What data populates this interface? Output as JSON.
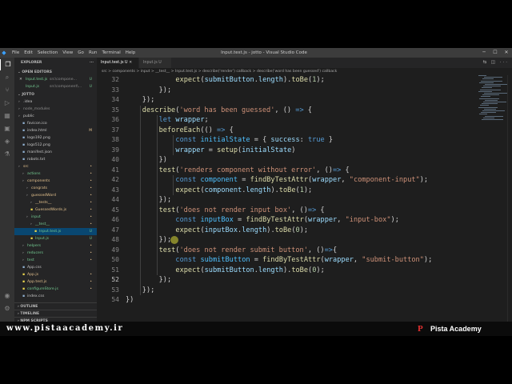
{
  "window": {
    "title": "Input.test.js - jotto - Visual Studio Code",
    "menu": [
      "File",
      "Edit",
      "Selection",
      "View",
      "Go",
      "Run",
      "Terminal",
      "Help"
    ]
  },
  "explorer": {
    "header": "EXPLORER",
    "open_editors_header": "OPEN EDITORS",
    "open_editors": [
      {
        "name": "Input.test.js",
        "path": "src\\compone...",
        "badge": "U"
      },
      {
        "name": "Input.js",
        "path": "src\\component\\...",
        "badge": "U"
      }
    ],
    "project_header": "JOTTO",
    "tree": [
      {
        "label": ".idea",
        "badge": "",
        "indent": 1,
        "kind": "folder"
      },
      {
        "label": "node_modules",
        "badge": "",
        "indent": 1,
        "kind": "folder-dim"
      },
      {
        "label": "public",
        "badge": "",
        "indent": 1,
        "kind": "folder"
      },
      {
        "label": "favicon.ico",
        "badge": "",
        "indent": 2,
        "kind": "file"
      },
      {
        "label": "index.html",
        "badge": "M",
        "indent": 2,
        "kind": "file"
      },
      {
        "label": "logo192.png",
        "badge": "",
        "indent": 2,
        "kind": "file"
      },
      {
        "label": "logo512.png",
        "badge": "",
        "indent": 2,
        "kind": "file"
      },
      {
        "label": "manifest.json",
        "badge": "",
        "indent": 2,
        "kind": "file"
      },
      {
        "label": "robots.txt",
        "badge": "",
        "indent": 2,
        "kind": "file"
      },
      {
        "label": "src",
        "badge": "",
        "indent": 1,
        "kind": "folder-mod"
      },
      {
        "label": "actions",
        "badge": "",
        "indent": 2,
        "kind": "folder-new"
      },
      {
        "label": "components",
        "badge": "",
        "indent": 2,
        "kind": "folder-mod"
      },
      {
        "label": "congrats",
        "badge": "",
        "indent": 3,
        "kind": "folder-mod"
      },
      {
        "label": "guessedWord",
        "badge": "",
        "indent": 3,
        "kind": "folder-mod"
      },
      {
        "label": "__tests__",
        "badge": "",
        "indent": 4,
        "kind": "folder-mod"
      },
      {
        "label": "GuessedWords.js",
        "badge": "",
        "indent": 4,
        "kind": "file-mod"
      },
      {
        "label": "input",
        "badge": "",
        "indent": 3,
        "kind": "folder-new"
      },
      {
        "label": "__test__",
        "badge": "",
        "indent": 4,
        "kind": "folder-new"
      },
      {
        "label": "Input.test.js",
        "badge": "U",
        "indent": 5,
        "kind": "file-new",
        "selected": true
      },
      {
        "label": "Input.js",
        "badge": "U",
        "indent": 4,
        "kind": "file-new"
      },
      {
        "label": "helpers",
        "badge": "",
        "indent": 2,
        "kind": "folder-new"
      },
      {
        "label": "reducers",
        "badge": "",
        "indent": 2,
        "kind": "folder-new"
      },
      {
        "label": "test",
        "badge": "",
        "indent": 2,
        "kind": "folder-new"
      },
      {
        "label": "App.css",
        "badge": "",
        "indent": 2,
        "kind": "file"
      },
      {
        "label": "App.js",
        "badge": "",
        "indent": 2,
        "kind": "file-mod"
      },
      {
        "label": "App.test.js",
        "badge": "",
        "indent": 2,
        "kind": "file-mod"
      },
      {
        "label": "configureStore.js",
        "badge": "",
        "indent": 2,
        "kind": "file-new"
      },
      {
        "label": "index.css",
        "badge": "",
        "indent": 2,
        "kind": "file"
      }
    ],
    "outline": "OUTLINE",
    "timeline": "TIMELINE",
    "npm_scripts": "NPM SCRIPTS"
  },
  "tabs": [
    {
      "label": "Input.test.js  U",
      "active": true
    },
    {
      "label": "Input.js  U",
      "active": false
    }
  ],
  "breadcrumb": "src > components > input > __test__ > Input.test.js > describe('render') callback > describe('word has been guessed') callback",
  "editor": {
    "current_line": 52,
    "line_numbers": [
      "32",
      "33",
      "34",
      "35",
      "36",
      "37",
      "38",
      "39",
      "40",
      "41",
      "42",
      "43",
      "44",
      "45",
      "46",
      "47",
      "48",
      "49",
      "50",
      "51",
      "52",
      "53",
      "54"
    ],
    "lines": [
      {
        "indent": 12,
        "tokens": [
          [
            "fn",
            "expect"
          ],
          [
            "pn",
            "("
          ],
          [
            "var",
            "submitButton"
          ],
          [
            "pn",
            "."
          ],
          [
            "var",
            "length"
          ],
          [
            "pn",
            ")."
          ],
          [
            "fn",
            "toBe"
          ],
          [
            "pn",
            "("
          ],
          [
            "num",
            "1"
          ],
          [
            "pn",
            ");"
          ]
        ]
      },
      {
        "indent": 8,
        "tokens": [
          [
            "pn",
            "});"
          ]
        ]
      },
      {
        "indent": 4,
        "tokens": [
          [
            "pn",
            "});"
          ]
        ]
      },
      {
        "indent": 4,
        "tokens": [
          [
            "fn",
            "describe"
          ],
          [
            "pn",
            "("
          ],
          [
            "str",
            "'word has been guessed'"
          ],
          [
            "pn",
            ", () "
          ],
          [
            "kw",
            "=>"
          ],
          [
            "pn",
            " {"
          ]
        ]
      },
      {
        "indent": 8,
        "tokens": [
          [
            "kw",
            "let"
          ],
          [
            "pn",
            " "
          ],
          [
            "var",
            "wrapper"
          ],
          [
            "pn",
            ";"
          ]
        ]
      },
      {
        "indent": 8,
        "tokens": [
          [
            "fn",
            "beforeEach"
          ],
          [
            "pn",
            "(() "
          ],
          [
            "kw",
            "=>"
          ],
          [
            "pn",
            " {"
          ]
        ]
      },
      {
        "indent": 12,
        "tokens": [
          [
            "kw",
            "const"
          ],
          [
            "pn",
            " "
          ],
          [
            "cst",
            "initialState"
          ],
          [
            "pn",
            " = { "
          ],
          [
            "var",
            "success"
          ],
          [
            "pn",
            ": "
          ],
          [
            "kw",
            "true"
          ],
          [
            "pn",
            " }"
          ]
        ]
      },
      {
        "indent": 12,
        "tokens": [
          [
            "var",
            "wrapper"
          ],
          [
            "pn",
            " = "
          ],
          [
            "fn",
            "setup"
          ],
          [
            "pn",
            "("
          ],
          [
            "var",
            "initialState"
          ],
          [
            "pn",
            ")"
          ]
        ]
      },
      {
        "indent": 8,
        "tokens": [
          [
            "pn",
            "})"
          ]
        ]
      },
      {
        "indent": 8,
        "tokens": [
          [
            "fn",
            "test"
          ],
          [
            "pn",
            "("
          ],
          [
            "str",
            "'renders component without error'"
          ],
          [
            "pn",
            ", ()"
          ],
          [
            "kw",
            "=>"
          ],
          [
            "pn",
            " {"
          ]
        ]
      },
      {
        "indent": 12,
        "tokens": [
          [
            "kw",
            "const"
          ],
          [
            "pn",
            " "
          ],
          [
            "cst",
            "component"
          ],
          [
            "pn",
            " = "
          ],
          [
            "fn",
            "findByTestAttr"
          ],
          [
            "pn",
            "("
          ],
          [
            "var",
            "wrapper"
          ],
          [
            "pn",
            ", "
          ],
          [
            "str",
            "\"component-input\""
          ],
          [
            "pn",
            ");"
          ]
        ]
      },
      {
        "indent": 12,
        "tokens": [
          [
            "fn",
            "expect"
          ],
          [
            "pn",
            "("
          ],
          [
            "var",
            "component"
          ],
          [
            "pn",
            "."
          ],
          [
            "var",
            "length"
          ],
          [
            "pn",
            ")."
          ],
          [
            "fn",
            "toBe"
          ],
          [
            "pn",
            "("
          ],
          [
            "num",
            "1"
          ],
          [
            "pn",
            ");"
          ]
        ]
      },
      {
        "indent": 8,
        "tokens": [
          [
            "pn",
            "});"
          ]
        ]
      },
      {
        "indent": 8,
        "tokens": [
          [
            "fn",
            "test"
          ],
          [
            "pn",
            "("
          ],
          [
            "str",
            "'does not render input box'"
          ],
          [
            "pn",
            ", ()"
          ],
          [
            "kw",
            "=>"
          ],
          [
            "pn",
            " {"
          ]
        ]
      },
      {
        "indent": 12,
        "tokens": [
          [
            "kw",
            "const"
          ],
          [
            "pn",
            " "
          ],
          [
            "cst",
            "inputBox"
          ],
          [
            "pn",
            " = "
          ],
          [
            "fn",
            "findByTestAttr"
          ],
          [
            "pn",
            "("
          ],
          [
            "var",
            "wrapper"
          ],
          [
            "pn",
            ", "
          ],
          [
            "str",
            "\"input-box\""
          ],
          [
            "pn",
            ");"
          ]
        ]
      },
      {
        "indent": 12,
        "tokens": [
          [
            "fn",
            "expect"
          ],
          [
            "pn",
            "("
          ],
          [
            "var",
            "inputBox"
          ],
          [
            "pn",
            "."
          ],
          [
            "var",
            "length"
          ],
          [
            "pn",
            ")."
          ],
          [
            "fn",
            "toBe"
          ],
          [
            "pn",
            "("
          ],
          [
            "num",
            "0"
          ],
          [
            "pn",
            ");"
          ]
        ]
      },
      {
        "indent": 8,
        "tokens": [
          [
            "pn",
            "});"
          ]
        ]
      },
      {
        "indent": 8,
        "tokens": [
          [
            "fn",
            "test"
          ],
          [
            "pn",
            "("
          ],
          [
            "str",
            "'does not render submit button'"
          ],
          [
            "pn",
            ", ()"
          ],
          [
            "kw",
            "=>"
          ],
          [
            "pn",
            "{"
          ]
        ]
      },
      {
        "indent": 12,
        "tokens": [
          [
            "kw",
            "const"
          ],
          [
            "pn",
            " "
          ],
          [
            "cst",
            "submitButton"
          ],
          [
            "pn",
            " = "
          ],
          [
            "fn",
            "findByTestAttr"
          ],
          [
            "pn",
            "("
          ],
          [
            "var",
            "wrapper"
          ],
          [
            "pn",
            ", "
          ],
          [
            "str",
            "\"submit-button\""
          ],
          [
            "pn",
            ");"
          ]
        ]
      },
      {
        "indent": 12,
        "tokens": [
          [
            "fn",
            "expect"
          ],
          [
            "pn",
            "("
          ],
          [
            "var",
            "submitButton"
          ],
          [
            "pn",
            "."
          ],
          [
            "var",
            "length"
          ],
          [
            "pn",
            ")."
          ],
          [
            "fn",
            "toBe"
          ],
          [
            "pn",
            "("
          ],
          [
            "num",
            "0"
          ],
          [
            "pn",
            ");"
          ]
        ]
      },
      {
        "indent": 8,
        "tokens": [
          [
            "pn",
            "});"
          ]
        ]
      },
      {
        "indent": 4,
        "tokens": [
          [
            "pn",
            "});"
          ]
        ]
      },
      {
        "indent": 0,
        "tokens": [
          [
            "pn",
            "})"
          ]
        ]
      }
    ]
  },
  "statusbar": {
    "branch": "master*",
    "sync": "⟳",
    "problems": "⊗ 0 ⚠ 0",
    "position": "Ln 52, Col 12",
    "spaces": "Spaces: 2",
    "encoding": "UTF-8",
    "eol": "CRLF",
    "language": "JavaScript",
    "go_live": "Go Live"
  },
  "watermark": {
    "url": "www.pistaacademy.ir",
    "brand": "Pista Academy",
    "logo": "P"
  },
  "colors": {
    "editor_bg": "#1e1e1e",
    "sidebar_bg": "#252526",
    "statusbar_bg": "#007acc",
    "brand_red": "#e03030"
  }
}
